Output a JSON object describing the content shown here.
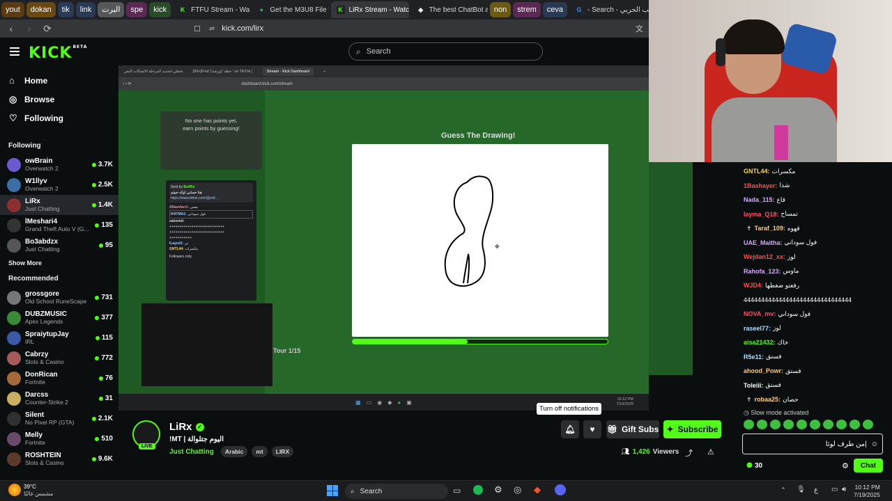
{
  "browser": {
    "bookmarks": [
      {
        "label": "yout",
        "color": "#5a3a12"
      },
      {
        "label": "dokan",
        "color": "#6a4a12"
      },
      {
        "label": "tik",
        "color": "#2a3a55"
      },
      {
        "label": "link",
        "color": "#2a3a55"
      },
      {
        "label": "البرت",
        "color": "#55575a"
      },
      {
        "label": "spe",
        "color": "#5a2a55"
      },
      {
        "label": "kick",
        "color": "#2a4a2a"
      }
    ],
    "tabs": [
      {
        "title": "FTFU Stream - Watch L",
        "icon": "kick-icon",
        "active": false
      },
      {
        "title": "Get the M3U8 File from",
        "icon": "globe-icon",
        "active": false
      },
      {
        "title": "LiRx Stream - Watc",
        "icon": "kick-icon",
        "active": true
      },
      {
        "title": "The best ChatBot and",
        "icon": "bot-icon",
        "active": false
      }
    ],
    "tab_chips": [
      {
        "label": "non",
        "color": "#6a5a12"
      },
      {
        "label": "strem",
        "color": "#5a2a55"
      },
      {
        "label": "ceva",
        "color": "#2a3a55"
      }
    ],
    "google_tab": "- Search - متعب الحربي",
    "url": "kick.com/lirx"
  },
  "header": {
    "logo": "KICK",
    "logo_badge": "BETA",
    "search_placeholder": "Search"
  },
  "nav": [
    {
      "label": "Home",
      "icon": "home-icon"
    },
    {
      "label": "Browse",
      "icon": "compass-icon"
    },
    {
      "label": "Following",
      "icon": "heart-icon"
    }
  ],
  "following": {
    "title": "Following",
    "channels": [
      {
        "name": "owBrain",
        "game": "Overwatch 2",
        "viewers": "3.7K",
        "color": "#6a5acd"
      },
      {
        "name": "W1llyv",
        "game": "Overwatch 2",
        "viewers": "2.5K",
        "color": "#3a6ea5"
      },
      {
        "name": "LiRx",
        "game": "Just Chatting",
        "viewers": "1.4K",
        "color": "#8a3030",
        "selected": true
      },
      {
        "name": "lMeshari4",
        "game": "Grand Theft Auto V (G...",
        "viewers": "135",
        "color": "#333"
      },
      {
        "name": "Bo3abdzx",
        "game": "Just Chatting",
        "viewers": "95",
        "color": "#555"
      }
    ],
    "show_more": "Show More"
  },
  "recommended": {
    "title": "Recommended",
    "channels": [
      {
        "name": "grossgore",
        "game": "Old School RuneScape",
        "viewers": "731",
        "color": "#777"
      },
      {
        "name": "DUBZMUSIC",
        "game": "Apex Legends",
        "viewers": "377",
        "color": "#3a8a3a"
      },
      {
        "name": "SpraiytupJay",
        "game": "IRL",
        "viewers": "115",
        "color": "#3a5aa5"
      },
      {
        "name": "Cabrzy",
        "game": "Slots & Casino",
        "viewers": "772",
        "color": "#a55a5a"
      },
      {
        "name": "DonRican",
        "game": "Fortnite",
        "viewers": "76",
        "color": "#a56a3a"
      },
      {
        "name": "Darcss",
        "game": "Counter-Strike 2",
        "viewers": "31",
        "color": "#c8b060"
      },
      {
        "name": "Silent",
        "game": "No Pixel RP (GTA)",
        "viewers": "2.1K",
        "color": "#303030"
      },
      {
        "name": "Melly",
        "game": "Fortnite",
        "viewers": "510",
        "color": "#6a4a6a"
      },
      {
        "name": "ROSHTEIN",
        "game": "Slots & Casino",
        "viewers": "9.6K",
        "color": "#5a3a2a"
      }
    ]
  },
  "capture": {
    "tabs": [
      "تخطي لتحديد المرحلة الاتصالات النص",
      "[99+]Find 'خطة '(ورشة) ' on TikTok |",
      "Stream - Kick Dashboard"
    ],
    "url": "dashboard.kick.com/stream",
    "points_line1": "No one has points yet,",
    "points_line2": "earn points by guessing!",
    "game_title": "Guess The Drawing!",
    "tour": "Tour 1/15",
    "progress": 0.45,
    "mini_chat": {
      "sent_by": "Sent by",
      "bot": "BotRix",
      "line1": "هنا حسابي لوكه حبيتم",
      "line2": "https://www.tiktok.com/@yx8...",
      "user1": "Albandarr1:",
      "user1_msg": "مقس",
      "user2": "IFATMA1:",
      "user2_msg": "فول سوداني",
      "user3": "saleemit:",
      "user4": "ILayed1:",
      "user4_msg": "تي",
      "user5": "GNTL44:",
      "user5_msg": "مكسرات",
      "followers": "Followers only"
    }
  },
  "taskbar_inner": {
    "time": "10:12 PM",
    "date": "7/19/2025"
  },
  "stream": {
    "streamer": "LiRx",
    "live_label": "LIVE",
    "title": "!MT | اليوم جتلوالة",
    "category": "Just Chatting",
    "tags": [
      "Arabic",
      "mt",
      "LIRX"
    ],
    "viewers": "1,426",
    "viewers_label": "Viewers",
    "tooltip": "Turn off notifications",
    "gift_label": "Gift Subs",
    "subscribe_label": "Subscribe"
  },
  "chat": {
    "messages": [
      {
        "user": "GNTL44:",
        "text": "مكسرات",
        "color": "#ffd54a"
      },
      {
        "user": "1Bashayer:",
        "text": "شذا",
        "color": "#ff4d4d"
      },
      {
        "user": "Nada_115:",
        "text": "قاع",
        "color": "#d9a6ff"
      },
      {
        "user": "layma_Q18:",
        "text": "تمساح",
        "color": "#ff4d6a"
      },
      {
        "user": "Taraf_109:",
        "text": "قهوه",
        "color": "#ffcc88",
        "badge": true
      },
      {
        "user": "UAE_Maitha:",
        "text": "فول سوداني",
        "color": "#d9a6ff"
      },
      {
        "user": "Wejdan12_xx:",
        "text": "لوز",
        "color": "#ff4d4d"
      },
      {
        "user": "Rahofa_123:",
        "text": "ماوس",
        "color": "#d9a6ff"
      },
      {
        "user": "WJD4:",
        "text": "رفعتو ضغطها",
        "color": "#ff4d4d"
      },
      {
        "user": "",
        "text": "4444444444444444444444444444444",
        "color": "#ffffff"
      },
      {
        "user": "NOVA_mv:",
        "text": "فول سوداني",
        "color": "#ff4d6a"
      },
      {
        "user": "raseel77:",
        "text": "لوز",
        "color": "#b0e0ff"
      },
      {
        "user": "aisa21432:",
        "text": "خاك",
        "color": "#53fc18"
      },
      {
        "user": "R5e11:",
        "text": "فستق",
        "color": "#b0e0ff"
      },
      {
        "user": "ahood_Powr:",
        "text": "فستق",
        "color": "#ffcc66"
      },
      {
        "user": "Toleiii:",
        "text": "فستق",
        "color": "#ffffff"
      },
      {
        "user": "robaa25:",
        "text": "حصان",
        "color": "#ffcc88",
        "badge": true
      }
    ],
    "slow_mode": "Slow mode activated",
    "input_value": "من طرف لوثا|",
    "points": "30",
    "chat_button": "Chat"
  },
  "os_taskbar": {
    "weather_temp": "39°C",
    "weather_desc": "مشمس غالبًا",
    "search_label": "Search",
    "lang": "ع",
    "time": "10:12 PM",
    "date": "7/19/2025"
  }
}
